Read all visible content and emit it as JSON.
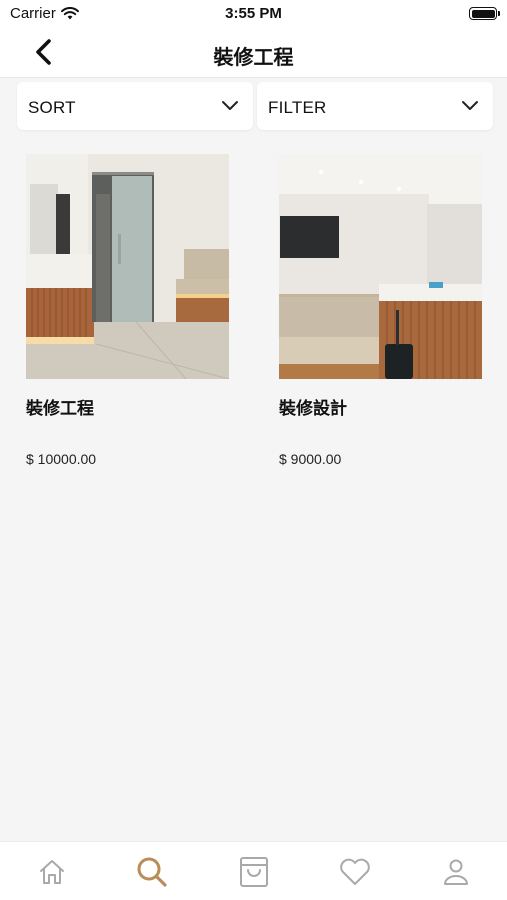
{
  "status_bar": {
    "carrier": "Carrier",
    "time": "3:55 PM",
    "wifi_icon": "wifi-icon",
    "battery_icon": "battery-icon"
  },
  "nav": {
    "title": "裝修工程",
    "back_icon": "chevron-left-icon"
  },
  "controls": {
    "sort_label": "SORT",
    "filter_label": "FILTER",
    "chevron_icon": "chevron-down-icon"
  },
  "products": [
    {
      "name": "裝修工程",
      "price": "$ 10000.00",
      "image": "reception-room-photo"
    },
    {
      "name": "裝修設計",
      "price": "$ 9000.00",
      "image": "waiting-room-photo"
    }
  ],
  "tab_bar": {
    "tabs": [
      {
        "icon": "home-icon",
        "active": false
      },
      {
        "icon": "search-icon",
        "active": true
      },
      {
        "icon": "shopping-bag-icon",
        "active": false
      },
      {
        "icon": "heart-icon",
        "active": false
      },
      {
        "icon": "user-icon",
        "active": false
      }
    ],
    "active_color": "#b98d57",
    "inactive_color": "#a9a9a9"
  }
}
